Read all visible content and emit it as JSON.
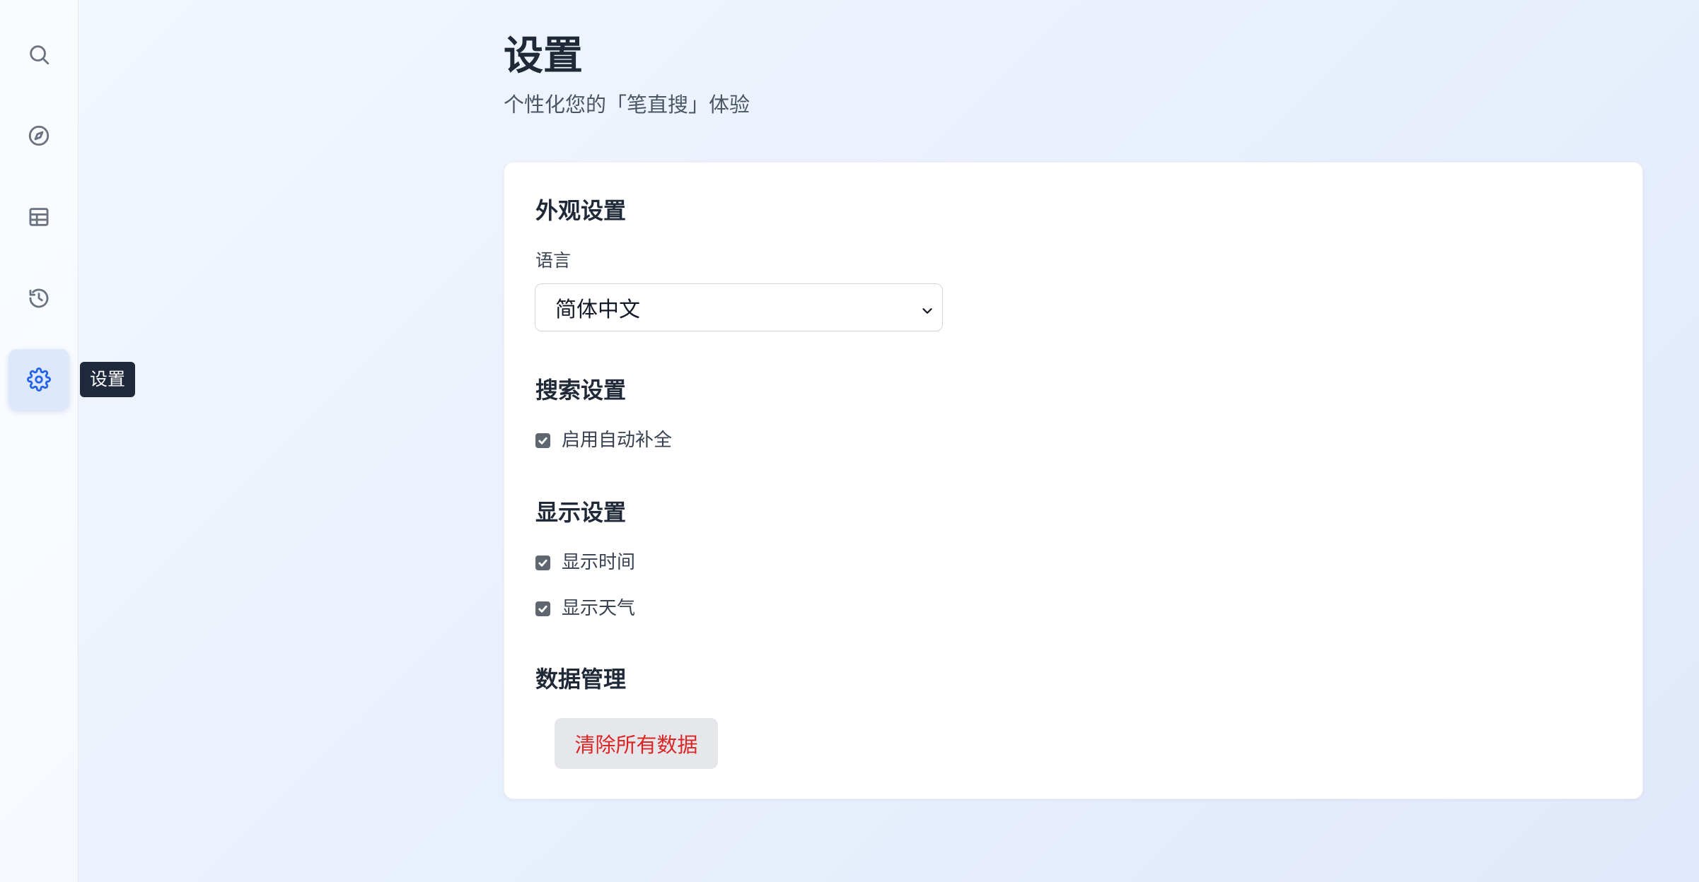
{
  "sidebar": {
    "items": [
      {
        "icon": "search-icon"
      },
      {
        "icon": "compass-icon"
      },
      {
        "icon": "table-icon"
      },
      {
        "icon": "history-icon"
      },
      {
        "icon": "gear-icon",
        "active": true
      }
    ],
    "tooltip": "设置"
  },
  "header": {
    "title": "设置",
    "subtitle": "个性化您的「笔直搜」体验"
  },
  "appearance": {
    "title": "外观设置",
    "language_label": "语言",
    "language_value": "简体中文"
  },
  "search_settings": {
    "title": "搜索设置",
    "autocomplete_label": "启用自动补全",
    "autocomplete_checked": true
  },
  "display_settings": {
    "title": "显示设置",
    "show_time_label": "显示时间",
    "show_time_checked": true,
    "show_weather_label": "显示天气",
    "show_weather_checked": true
  },
  "data_management": {
    "title": "数据管理",
    "clear_button_label": "清除所有数据"
  },
  "colors": {
    "accent": "#2563eb",
    "danger": "#dc2626",
    "tooltip_bg": "#1e293b"
  }
}
